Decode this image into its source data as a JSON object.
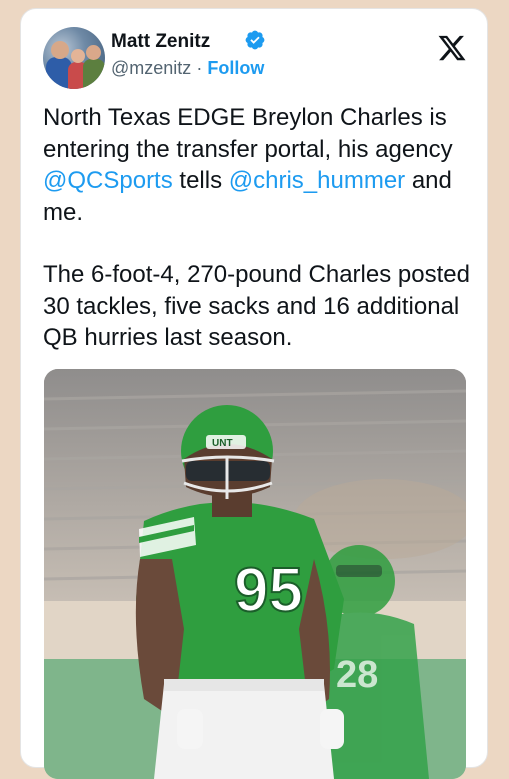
{
  "tweet": {
    "author_name": "Matt Zenitz",
    "handle": "@mzenitz",
    "separator": "·",
    "follow_label": "Follow",
    "line1_pre": "North Texas EDGE Breylon Charles is entering the transfer portal, his agency ",
    "mention1": "@QCSports",
    "line1_mid": " tells ",
    "mention2": "@chris_hummer",
    "line1_post": " and me.",
    "paragraph2": "The 6-foot-4, 270-pound Charles posted 30 tackles, five sacks and 16 additional QB hurries last season.",
    "helmet_text": "UNT",
    "jersey_number": "95"
  },
  "colors": {
    "accent": "#1d9bf0",
    "background": "#ecd7c3",
    "jersey_green": "#2f9e3f"
  },
  "icons": [
    "verified-badge-icon",
    "x-logo-icon"
  ]
}
